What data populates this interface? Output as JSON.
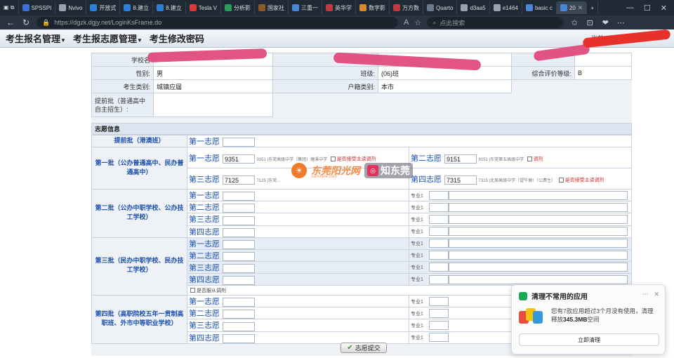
{
  "browser": {
    "tabs": [
      {
        "label": "SPSSPI",
        "color": "#3a6fd8"
      },
      {
        "label": "Nvivo",
        "color": "#9aa3ad"
      },
      {
        "label": "开放式",
        "color": "#2b7fd6"
      },
      {
        "label": "8.建立",
        "color": "#2b7fd6"
      },
      {
        "label": "8.建立",
        "color": "#2b7fd6"
      },
      {
        "label": "Tesla V",
        "color": "#d63a3a"
      },
      {
        "label": "分析影",
        "color": "#2b9a5a"
      },
      {
        "label": "国家社",
        "color": "#8b5a2b"
      },
      {
        "label": "三重一",
        "color": "#4a86d6"
      },
      {
        "label": "英华学",
        "color": "#c43a3a"
      },
      {
        "label": "数字影",
        "color": "#d68a2b"
      },
      {
        "label": "万方数",
        "color": "#c43a3a"
      },
      {
        "label": "Quarto",
        "color": "#6a7a8a"
      },
      {
        "label": "d3aa5",
        "color": "#9aa3ad"
      },
      {
        "label": "e1464",
        "color": "#9aa3ad"
      },
      {
        "label": "basic c",
        "color": "#4a86d6"
      },
      {
        "label": "20",
        "color": "#4a86d6"
      }
    ],
    "url": "https://dgzk.dgjy.net/LoginKsFrame.do",
    "search_placeholder": "点此搜索"
  },
  "menu": {
    "items": [
      "考生报名管理",
      "考生报志愿管理",
      "考生修改密码"
    ],
    "right_text": "当前"
  },
  "info": {
    "school_label": "学校名",
    "gender_label": "性别:",
    "gender_value": "男",
    "class_label": "班级:",
    "class_value": "(06)班",
    "eval_label": "综合评价等级:",
    "eval_value": "B",
    "type_label": "考生类别:",
    "type_value": "城镇应届",
    "hukou_label": "户籍类别:",
    "hukou_value": "本市",
    "early_label": "提前批（普通高中自主招生）:"
  },
  "wishes": {
    "section_title": "志愿信息",
    "batch0": "提前批（港澳班）",
    "batch1": "第一批（公办普通高中、民办普通高中）",
    "batch2": "第二批（公办中职学校、公办技工学校）",
    "batch3": "第三批（民办中职学校、民办技工学校）",
    "batch4": "第四批（高职院校五年一贯制高职班、外市中等职业学校）",
    "choices": [
      "第一志愿",
      "第二志愿",
      "第三志愿",
      "第四志愿"
    ],
    "b1": [
      {
        "code": "9351",
        "school": "9351 |东莞高级中学（集团）塘溪中学"
      },
      {
        "code": "9151",
        "school": "9151 |东莞第五高级中学"
      },
      {
        "code": "7125",
        "school": "7125 |东莞..."
      },
      {
        "code": "7315",
        "school": "7315 |北辰高级中学（望牛墩）（公费生）"
      }
    ],
    "adjust_label": "是否接受主读调剂",
    "adjust_label2": "调剂",
    "obey_label": "是否服从调剂",
    "major_label": "专业1",
    "submit_label": "志愿提交"
  },
  "watermark": {
    "site1": "东莞阳光网",
    "site1_sub": "sunshine.com",
    "site2": "知东莞",
    "site2_badge": "◎"
  },
  "toast": {
    "title": "清理不常用的应用",
    "body_pre": "您有7款应用超过3个月没有使用，清理释放",
    "body_size": "345.3MB",
    "body_post": "空间",
    "button": "立即清理"
  }
}
